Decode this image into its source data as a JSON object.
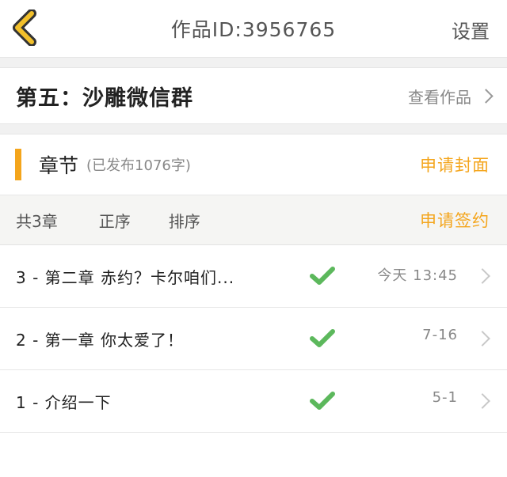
{
  "header": {
    "title": "作品ID:3956765",
    "settings_label": "设置"
  },
  "work": {
    "title": "第五：沙雕微信群",
    "view_label": "查看作品"
  },
  "chapter": {
    "title": "章节",
    "subtitle": "(已发布1076字)",
    "apply_cover_label": "申请封面"
  },
  "filter": {
    "count_label": "共3章",
    "sort_asc_label": "正序",
    "sort_label": "排序",
    "apply_contract_label": "申请签约"
  },
  "chapters": [
    {
      "title": "3 - 第二章 赤约？卡尔咱们...",
      "time": "今天 13:45"
    },
    {
      "title": "2 - 第一章 你太爱了！",
      "time": "7-16"
    },
    {
      "title": "1 - 介绍一下",
      "time": "5-1"
    }
  ],
  "colors": {
    "accent": "#f4a51c",
    "check": "#5cb85c",
    "back_icon": "#f2c02b"
  }
}
